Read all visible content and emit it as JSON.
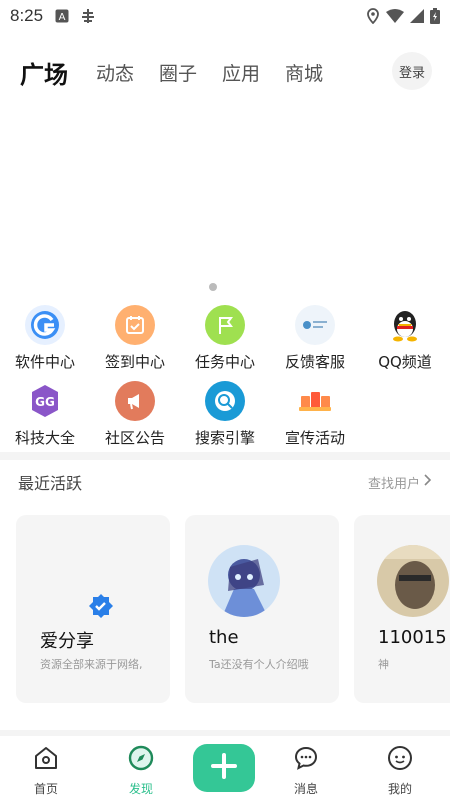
{
  "status_bar": {
    "time": "8:25"
  },
  "header": {
    "tabs": [
      {
        "label": "广场"
      },
      {
        "label": "动态"
      },
      {
        "label": "圈子"
      },
      {
        "label": "应用"
      },
      {
        "label": "商城"
      }
    ],
    "login_label": "登录"
  },
  "quick_grid": [
    {
      "label": "软件中心",
      "icon": "software-center-icon",
      "color": "#3b8ff5"
    },
    {
      "label": "签到中心",
      "icon": "checkin-icon",
      "color": "#ff9a4a"
    },
    {
      "label": "任务中心",
      "icon": "flag-icon",
      "color": "#8fdc3a"
    },
    {
      "label": "反馈客服",
      "icon": "feedback-icon",
      "color": "#d7e8f5"
    },
    {
      "label": "QQ频道",
      "icon": "qq-icon",
      "color": "#222222"
    },
    {
      "label": "科技大全",
      "icon": "gg-icon",
      "color": "#8a56c8"
    },
    {
      "label": "社区公告",
      "icon": "megaphone-icon",
      "color": "#d45c3a"
    },
    {
      "label": "搜索引擎",
      "icon": "search-globe-icon",
      "color": "#1a9ad6"
    },
    {
      "label": "宣传活动",
      "icon": "promo-icon",
      "color": "#ff6a3a"
    }
  ],
  "recent": {
    "title": "最近活跃",
    "find_user": "查找用户",
    "users": [
      {
        "name": "爱分享",
        "bio": "资源全部来源于网络,",
        "verified": true
      },
      {
        "name": "the",
        "bio": "Ta还没有个人介绍哦"
      },
      {
        "name": "110015",
        "bio": "神"
      }
    ]
  },
  "bottom_nav": [
    {
      "label": "首页",
      "icon": "home-icon"
    },
    {
      "label": "发现",
      "icon": "compass-icon",
      "active": true
    },
    {
      "label": "",
      "icon": "plus-icon"
    },
    {
      "label": "消息",
      "icon": "message-icon"
    },
    {
      "label": "我的",
      "icon": "profile-icon"
    }
  ],
  "colors": {
    "accent": "#34c796"
  }
}
